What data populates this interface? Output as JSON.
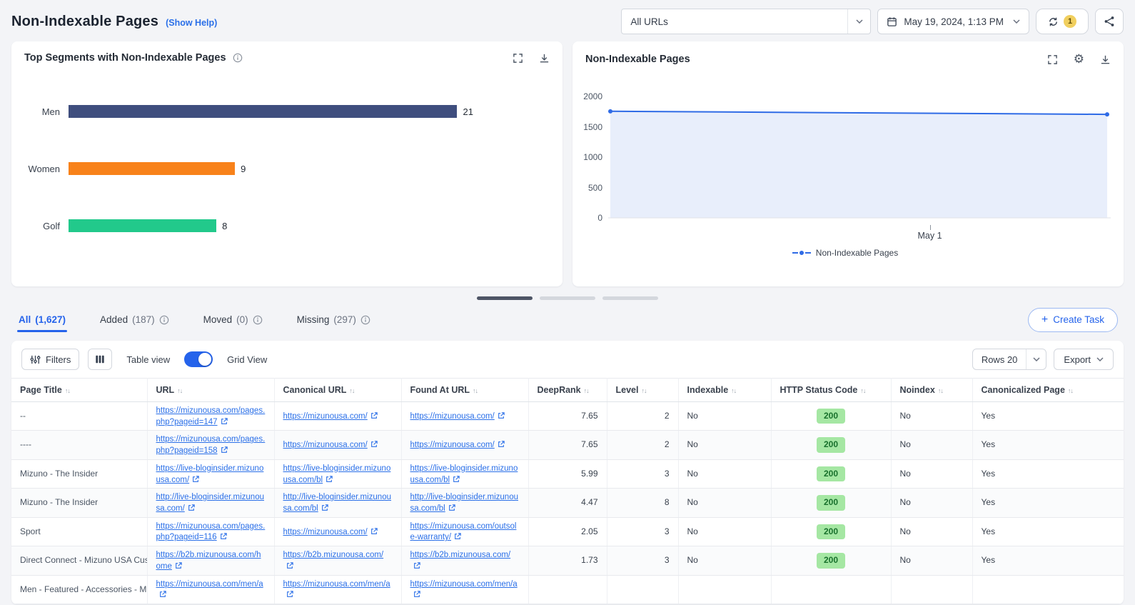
{
  "header": {
    "title": "Non-Indexable Pages",
    "help_link": "(Show Help)",
    "url_filter": "All URLs",
    "date": "May 19, 2024, 1:13 PM",
    "refresh_count": "1"
  },
  "segments_card": {
    "title": "Top Segments with Non-Indexable Pages",
    "chart_data": {
      "type": "bar",
      "orientation": "horizontal",
      "categories": [
        "Men",
        "Women",
        "Golf"
      ],
      "values": [
        21,
        9,
        8
      ],
      "colors": [
        "#3f4e7e",
        "#f8821a",
        "#22c98b"
      ],
      "xlim": [
        0,
        21
      ]
    }
  },
  "trend_card": {
    "title": "Non-Indexable Pages",
    "chart_data": {
      "type": "area",
      "series": [
        {
          "name": "Non-Indexable Pages",
          "values": [
            1755,
            1705
          ],
          "color": "#2f6be6"
        }
      ],
      "ylim": [
        0,
        2000
      ],
      "y_ticks": [
        2000,
        1500,
        1000,
        500,
        0
      ],
      "x_ticks": [
        {
          "label": "May 1",
          "position": 0.64
        }
      ],
      "legend_position": "bottom"
    }
  },
  "carousel": {
    "segments": 3,
    "active_index": 0
  },
  "tabs": [
    {
      "label": "All",
      "count": "(1,627)",
      "active": true,
      "info": false
    },
    {
      "label": "Added",
      "count": "(187)",
      "active": false,
      "info": true
    },
    {
      "label": "Moved",
      "count": "(0)",
      "active": false,
      "info": true
    },
    {
      "label": "Missing",
      "count": "(297)",
      "active": false,
      "info": true
    }
  ],
  "create_task_label": "Create Task",
  "toolbar": {
    "filters_label": "Filters",
    "table_view_label": "Table view",
    "grid_view_label": "Grid View",
    "rows_label": "Rows",
    "rows_value": "20",
    "export_label": "Export"
  },
  "table": {
    "columns": [
      "Page Title",
      "URL",
      "Canonical URL",
      "Found At URL",
      "DeepRank",
      "Level",
      "Indexable",
      "HTTP Status Code",
      "Noindex",
      "Canonicalized Page"
    ],
    "rows": [
      {
        "page_title": "--",
        "url": "https://mizunousa.com/pages.php?pageid=147",
        "canonical_url": "https://mizunousa.com/",
        "found_at_url": "https://mizunousa.com/",
        "deeprank": "7.65",
        "level": "2",
        "indexable": "No",
        "http_status_code": "200",
        "noindex": "No",
        "canonicalized_page": "Yes"
      },
      {
        "page_title": "----",
        "url": "https://mizunousa.com/pages.php?pageid=158",
        "canonical_url": "https://mizunousa.com/",
        "found_at_url": "https://mizunousa.com/",
        "deeprank": "7.65",
        "level": "2",
        "indexable": "No",
        "http_status_code": "200",
        "noindex": "No",
        "canonicalized_page": "Yes"
      },
      {
        "page_title": "Mizuno - The Insider",
        "url": "https://live-bloginsider.mizunousa.com/",
        "canonical_url": "https://live-bloginsider.mizunousa.com/bl",
        "found_at_url": "https://live-bloginsider.mizunousa.com/bl",
        "deeprank": "5.99",
        "level": "3",
        "indexable": "No",
        "http_status_code": "200",
        "noindex": "No",
        "canonicalized_page": "Yes"
      },
      {
        "page_title": "Mizuno - The Insider",
        "url": "http://live-bloginsider.mizunousa.com/",
        "canonical_url": "http://live-bloginsider.mizunousa.com/bl",
        "found_at_url": "http://live-bloginsider.mizunousa.com/bl",
        "deeprank": "4.47",
        "level": "8",
        "indexable": "No",
        "http_status_code": "200",
        "noindex": "No",
        "canonicalized_page": "Yes"
      },
      {
        "page_title": "Sport",
        "url": "https://mizunousa.com/pages.php?pageid=116",
        "canonical_url": "https://mizunousa.com/",
        "found_at_url": "https://mizunousa.com/outsole-warranty/",
        "deeprank": "2.05",
        "level": "3",
        "indexable": "No",
        "http_status_code": "200",
        "noindex": "No",
        "canonicalized_page": "Yes"
      },
      {
        "page_title": "Direct Connect - Mizuno USA Custo",
        "url": "https://b2b.mizunousa.com/home",
        "canonical_url": "https://b2b.mizunousa.com/",
        "found_at_url": "https://b2b.mizunousa.com/",
        "deeprank": "1.73",
        "level": "3",
        "indexable": "No",
        "http_status_code": "200",
        "noindex": "No",
        "canonicalized_page": "Yes"
      },
      {
        "page_title": "Men - Featured - Accessories - Miz",
        "url": "https://mizunousa.com/men/a",
        "canonical_url": "https://mizunousa.com/men/a",
        "found_at_url": "https://mizunousa.com/men/a",
        "deeprank": "",
        "level": "",
        "indexable": "",
        "http_status_code": "",
        "noindex": "",
        "canonicalized_page": ""
      }
    ]
  }
}
